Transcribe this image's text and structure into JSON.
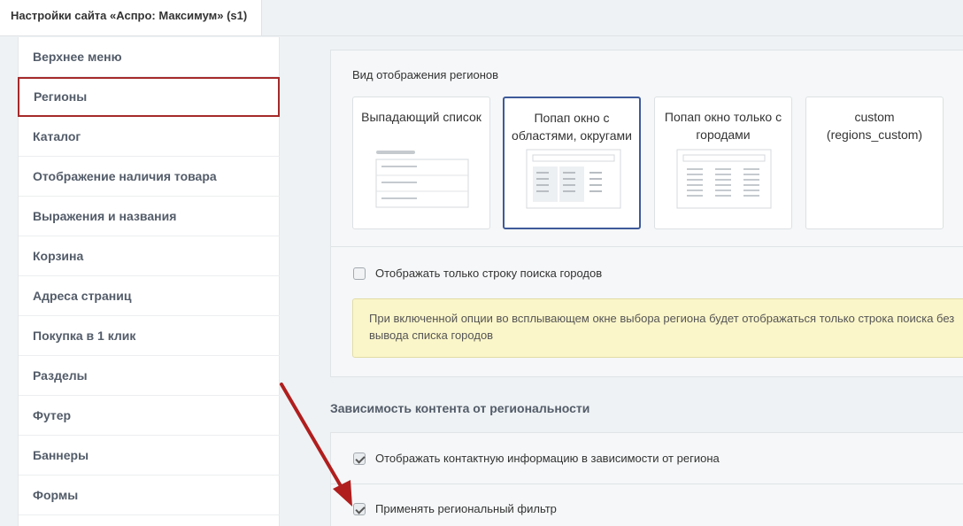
{
  "window": {
    "tab_title": "Настройки сайта «Аспро: Максимум» (s1)"
  },
  "sidebar": {
    "items": [
      {
        "label": "Верхнее меню"
      },
      {
        "label": "Регионы",
        "active": true
      },
      {
        "label": "Каталог"
      },
      {
        "label": "Отображение наличия товара"
      },
      {
        "label": "Выражения и названия"
      },
      {
        "label": "Корзина"
      },
      {
        "label": "Адреса страниц"
      },
      {
        "label": "Покупка в 1 клик"
      },
      {
        "label": "Разделы"
      },
      {
        "label": "Футер"
      },
      {
        "label": "Баннеры"
      },
      {
        "label": "Формы"
      }
    ]
  },
  "regions_view": {
    "title": "Вид отображения регионов",
    "options": [
      {
        "label": "Выпадающий список",
        "selected": false
      },
      {
        "label": "Попап окно с областями, округами",
        "selected": true
      },
      {
        "label": "Попап окно только с городами",
        "selected": false
      },
      {
        "label": "custom (regions_custom)",
        "selected": false
      }
    ]
  },
  "search_only": {
    "label": "Отображать только строку поиска городов",
    "checked": false,
    "note": "При включенной опции во всплывающем окне выбора региона будет отображаться только строка поиска без вывода списка городов"
  },
  "content_dependency": {
    "title": "Зависимость контента от региональности",
    "options": [
      {
        "label": "Отображать контактную информацию в зависимости от региона",
        "checked": true
      },
      {
        "label": "Применять региональный фильтр",
        "checked": true
      }
    ]
  },
  "colors": {
    "selected_border": "#3e5a9a",
    "active_menu_border": "#a52a2a",
    "arrow": "#b01e1e",
    "note_bg": "#fbf6c9"
  }
}
